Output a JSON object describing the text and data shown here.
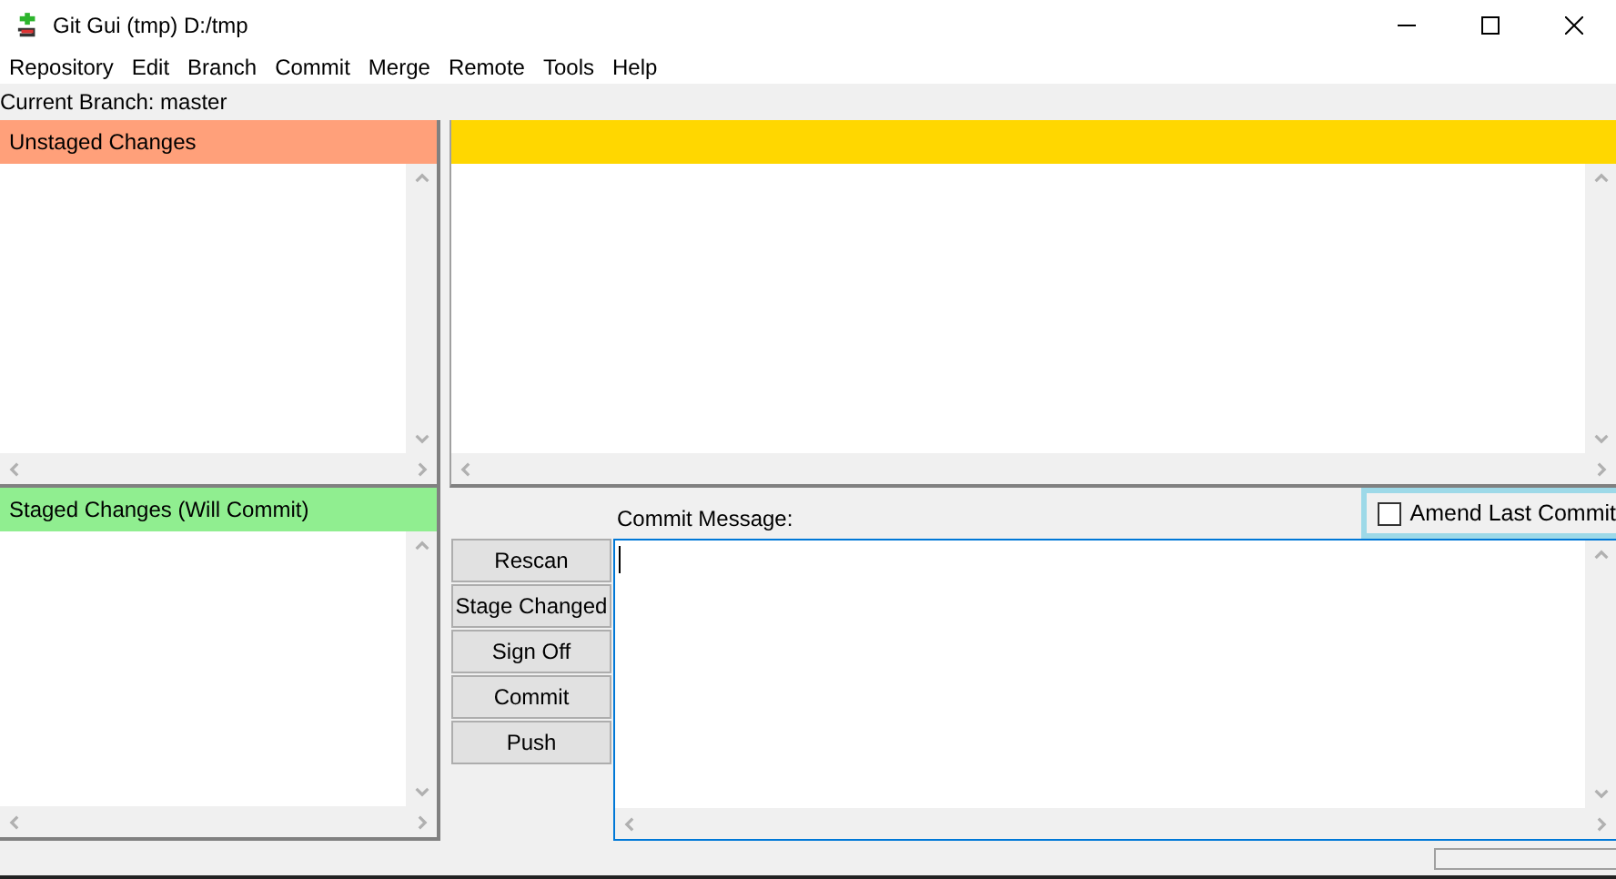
{
  "window": {
    "title": "Git Gui (tmp) D:/tmp"
  },
  "menu": [
    "Repository",
    "Edit",
    "Branch",
    "Commit",
    "Merge",
    "Remote",
    "Tools",
    "Help"
  ],
  "current_branch": "Current Branch: master",
  "unstaged": {
    "title": "Unstaged Changes"
  },
  "staged": {
    "title": "Staged Changes (Will Commit)"
  },
  "actions": [
    "Rescan",
    "Stage Changed",
    "Sign Off",
    "Commit",
    "Push"
  ],
  "commit_message": {
    "label": "Commit Message:"
  },
  "amend": {
    "label": "Amend Last Commit",
    "checked": false
  }
}
